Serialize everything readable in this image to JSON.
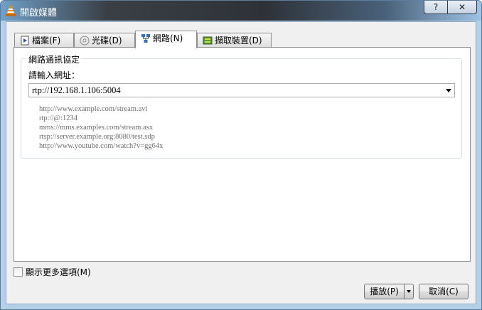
{
  "window": {
    "title": "開啟媒體",
    "help_label": "?",
    "close_label": "✕"
  },
  "tabs": [
    {
      "label": "檔案(F)",
      "icon": "file-icon"
    },
    {
      "label": "光碟(D)",
      "icon": "disc-icon"
    },
    {
      "label": "網路(N)",
      "icon": "network-icon",
      "active": true
    },
    {
      "label": "擷取裝置(D)",
      "icon": "capture-device-icon"
    }
  ],
  "network": {
    "group_title": "網路通訊協定",
    "url_label": "請輸入網址：",
    "url_value": "rtp://192.168.1.106:5004",
    "examples": [
      "http://www.example.com/stream.avi",
      "rtp://@:1234",
      "mms://mms.examples.com/stream.asx",
      "rtsp://server.example.org:8080/test.sdp",
      "http://www.youtube.com/watch?v=gg64x"
    ]
  },
  "options": {
    "show_more_label": "顯示更多選項(M)",
    "show_more_checked": false
  },
  "buttons": {
    "play_label": "播放(P)",
    "cancel_label": "取消(C)"
  },
  "colors": {
    "titlebar_dark": "#2e3238",
    "frame": "#b4cfe8",
    "vlc_orange": "#f08c00"
  }
}
